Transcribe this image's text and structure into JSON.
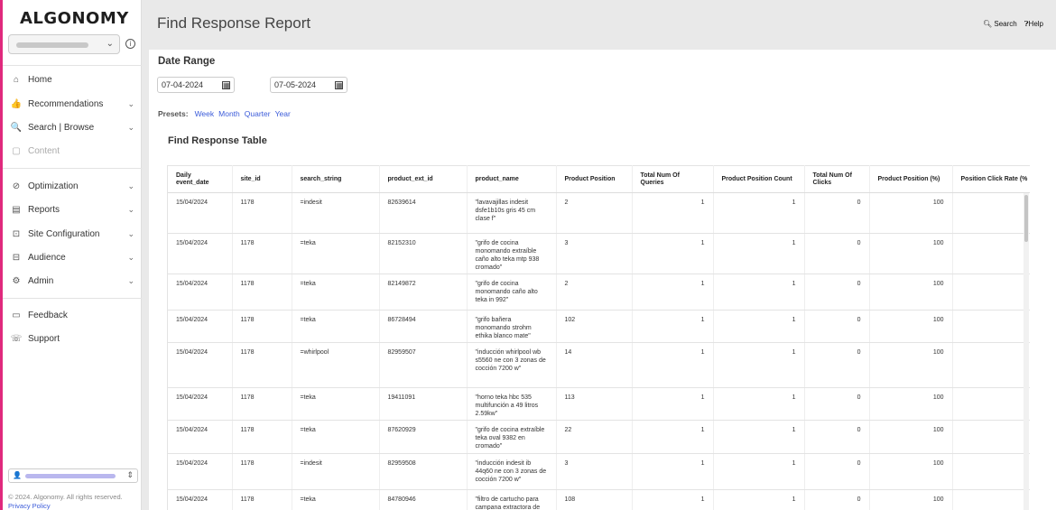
{
  "brand": {
    "logo": "ALGONOMY",
    "accent": "#e0297d",
    "link_color": "#3b5bd9"
  },
  "sidebar": {
    "org_select": {
      "value_hidden": true,
      "chevron": "chevron-down-icon"
    },
    "items": [
      {
        "label": "Home",
        "icon": "home-icon"
      },
      {
        "label": "Recommendations",
        "icon": "thumbs-up-icon"
      },
      {
        "label": "Search | Browse",
        "icon": "search-icon"
      },
      {
        "label": "Content",
        "icon": "content-icon"
      },
      {
        "label": "Optimization",
        "icon": "optimization-icon"
      },
      {
        "label": "Reports",
        "icon": "reports-icon"
      },
      {
        "label": "Site Configuration",
        "icon": "site-config-icon"
      },
      {
        "label": "Audience",
        "icon": "audience-icon"
      },
      {
        "label": "Admin",
        "icon": "admin-icon"
      },
      {
        "label": "Feedback",
        "icon": "feedback-icon"
      },
      {
        "label": "Support",
        "icon": "support-icon"
      }
    ],
    "copyright": "© 2024. Algonomy. All rights reserved.",
    "privacy": "Privacy Policy"
  },
  "header": {
    "title": "Find Response Report",
    "search": "Search",
    "help": "Help"
  },
  "filters": {
    "date_range_label": "Date Range",
    "start_date": "07-04-2024",
    "end_date": "07-05-2024",
    "presets_label": "Presets:",
    "presets": [
      "Week",
      "Month",
      "Quarter",
      "Year"
    ]
  },
  "table": {
    "title": "Find Response Table",
    "columns": [
      "Daily event_date",
      "site_id",
      "search_string",
      "product_ext_id",
      "product_name",
      "Product Position",
      "Total Num Of Queries",
      "Product Position Count",
      "Total Num Of Clicks",
      "Product Position (%)",
      "Position Click Rate (%"
    ],
    "rows": [
      [
        "15/04/2024",
        "1178",
        "=indesit",
        "82639614",
        "\"lavavajillas indesit dsfe1b10s gris 45 cm clase f\"",
        "2",
        "1",
        "1",
        "0",
        "100",
        ""
      ],
      [
        "15/04/2024",
        "1178",
        "=teka",
        "82152310",
        "\"grifo de cocina monomando extraíble caño alto teka mtp 938 cromado\"",
        "3",
        "1",
        "1",
        "0",
        "100",
        ""
      ],
      [
        "15/04/2024",
        "1178",
        "=teka",
        "82149872",
        "\"grifo de cocina monomando caño alto teka in 992\"",
        "2",
        "1",
        "1",
        "0",
        "100",
        ""
      ],
      [
        "15/04/2024",
        "1178",
        "=teka",
        "86728494",
        "\"grifo bañera monomando strohm ethika blanco mate\"",
        "102",
        "1",
        "1",
        "0",
        "100",
        ""
      ],
      [
        "15/04/2024",
        "1178",
        "=whirlpool",
        "82959507",
        "\"inducción whirlpool wb s5560 ne con 3 zonas de cocción 7200 w\"",
        "14",
        "1",
        "1",
        "0",
        "100",
        ""
      ],
      [
        "15/04/2024",
        "1178",
        "=teka",
        "19411091",
        "\"horno teka hbc 535 multifunción a 49 litros 2.59kw\"",
        "113",
        "1",
        "1",
        "0",
        "100",
        ""
      ],
      [
        "15/04/2024",
        "1178",
        "=teka",
        "87620929",
        "\"grifo de cocina extraíble teka oval 9382 en cromado\"",
        "22",
        "1",
        "1",
        "0",
        "100",
        ""
      ],
      [
        "15/04/2024",
        "1178",
        "=indesit",
        "82959508",
        "\"inducción indesit ib 44q60 ne con 3 zonas de cocción 7200 w\"",
        "3",
        "1",
        "1",
        "0",
        "100",
        ""
      ],
      [
        "15/04/2024",
        "1178",
        "=teka",
        "84780946",
        "\"filtro de cartucho para campana extractora de",
        "108",
        "1",
        "1",
        "0",
        "100",
        ""
      ]
    ]
  }
}
